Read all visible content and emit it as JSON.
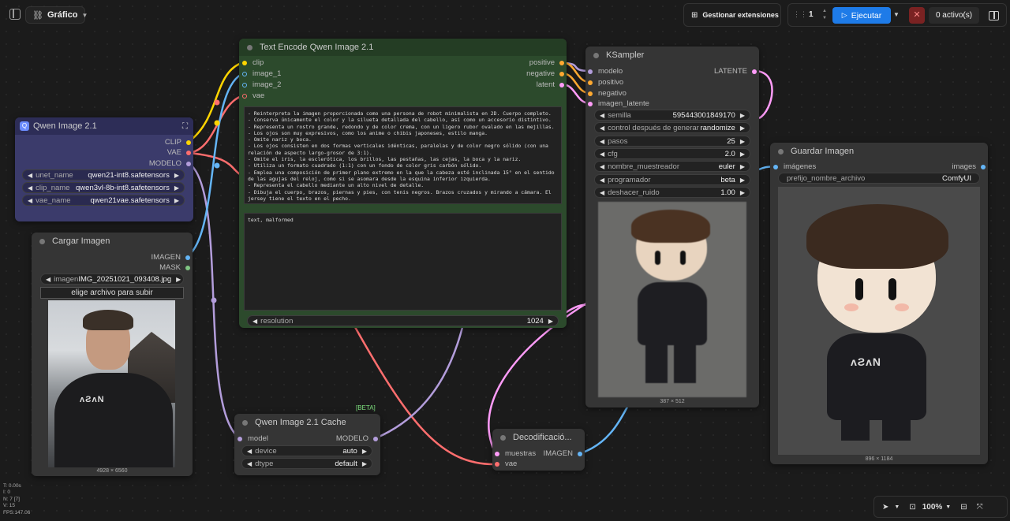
{
  "topbar": {
    "graph_label": "Gráfico",
    "manage_extensions": "Gestionar extensiones",
    "queue_count": "1",
    "run_label": "Ejecutar",
    "active_label": "0 activo(s)"
  },
  "colors": {
    "accent": "#1e7be8",
    "clip": "#ffd500",
    "vae": "#ff6e6e",
    "model": "#b39ddb",
    "image": "#64b5f6",
    "latent": "#ff9cf9",
    "conditioning": "#ffa931",
    "mask": "#81c784",
    "cancel": "#7a2222"
  },
  "qwen_loader": {
    "title": "Qwen Image 2.1",
    "outputs": [
      "CLIP",
      "VAE",
      "MODELO"
    ],
    "widgets": [
      {
        "label": "unet_name",
        "value": "qwen21-int8.safetensors"
      },
      {
        "label": "clip_name",
        "value": "qwen3vl-8b-int8.safetensors"
      },
      {
        "label": "vae_name",
        "value": "qwen21vae.safetensors"
      }
    ]
  },
  "load_image": {
    "title": "Cargar Imagen",
    "outputs": [
      "IMAGEN",
      "MASK"
    ],
    "widget": {
      "label": "imagen",
      "value": "IMG_20251021_093408.jpg"
    },
    "upload_label": "elige archivo para subir",
    "dims": "4928 × 6560"
  },
  "text_encode": {
    "title": "Text Encode Qwen Image 2.1",
    "inputs": [
      "clip",
      "image_1",
      "image_2",
      "vae"
    ],
    "outputs": [
      "positive",
      "negative",
      "latent"
    ],
    "positive_text": "- Reinterpreta la imagen proporcionada como una persona de robot minimalista en 2D. Cuerpo completo.\n- Conserva únicamente el color y la silueta detallada del cabello, así como un accesorio distintivo.\n- Representa un rostro grande, redondo y de color crema, con un ligero rubor ovalado en las mejillas.\n- Los ojos son muy expresivos, como los anime o chibis japoneses, estilo manga.\n- Omite nariz y boca.\n- Los ojos consisten en dos formas verticales idénticas, paralelas y de color negro sólido (con una relación de aspecto largo-grosor de 3:1).\n- Omite el iris, la esclerótica, los brillos, las pestañas, las cejas, la boca y la nariz.\n- Utiliza un formato cuadrado (1:1) con un fondo de color gris carbón sólido.\n- Emplea una composición de primer plano extremo en la que la cabeza esté inclinada 15° en el sentido de las agujas del reloj, como si se asomara desde la esquina inferior izquierda.\n- Representa el cabello mediante un alto nivel de detalle.\n- Dibuja el cuerpo, brazos, piernas y pies, con tenis negros. Brazos cruzados y mirando a cámara. El jersey tiene el texto en el pecho.",
    "negative_text": "text, malformed",
    "resolution": {
      "label": "resolution",
      "value": "1024"
    }
  },
  "ksampler": {
    "title": "KSampler",
    "inputs": [
      "modelo",
      "positivo",
      "negativo",
      "imagen_latente"
    ],
    "output": "LATENTE",
    "widgets": [
      {
        "label": "semilla",
        "value": "595443001849170"
      },
      {
        "label": "control después de generar",
        "value": "randomize"
      },
      {
        "label": "pasos",
        "value": "25"
      },
      {
        "label": "cfg",
        "value": "2.0"
      },
      {
        "label": "nombre_muestreador",
        "value": "euler"
      },
      {
        "label": "programador",
        "value": "beta"
      },
      {
        "label": "deshacer_ruido",
        "value": "1.00"
      }
    ],
    "dims": "387 × 512"
  },
  "save_image": {
    "title": "Guardar Imagen",
    "input": "imágenes",
    "output": "images",
    "widget": {
      "label": "prefijo_nombre_archivo",
      "value": "ComfyUI"
    },
    "dims": "896 × 1184"
  },
  "cache_node": {
    "badge": "[BETA]",
    "title": "Qwen Image 2.1 Cache",
    "input": "model",
    "output": "MODELO",
    "widgets": [
      {
        "label": "device",
        "value": "auto"
      },
      {
        "label": "dtype",
        "value": "default"
      }
    ]
  },
  "vae_decode": {
    "title": "Decodificació...",
    "inputs": [
      "muestras",
      "vae"
    ],
    "output": "IMAGEN"
  },
  "stats": [
    "T: 0.00s",
    "I: 0",
    "N: 7 [7]",
    "V: 15",
    "FPS:147.06"
  ],
  "bottom_bar": {
    "zoom": "100%"
  }
}
